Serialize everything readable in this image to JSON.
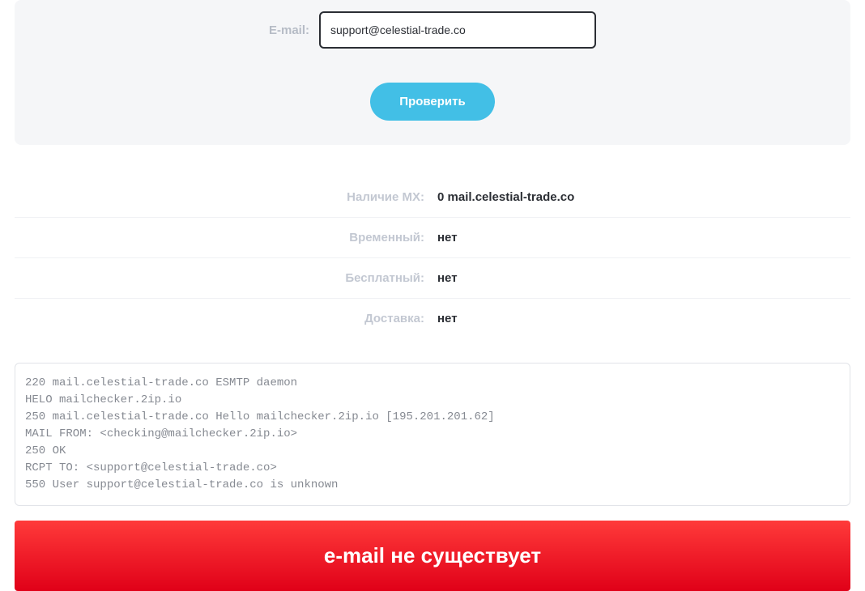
{
  "form": {
    "email_label": "E-mail:",
    "email_value": "support@celestial-trade.co",
    "check_button": "Проверить"
  },
  "result": {
    "mx_label": "Наличие MX:",
    "mx_value": "0 mail.celestial-trade.co",
    "temp_label": "Временный:",
    "temp_value": "нет",
    "free_label": "Бесплатный:",
    "free_value": "нет",
    "delivery_label": "Доставка:",
    "delivery_value": "нет"
  },
  "log": "220 mail.celestial-trade.co ESMTP daemon\nHELO mailchecker.2ip.io\n250 mail.celestial-trade.co Hello mailchecker.2ip.io [195.201.201.62]\nMAIL FROM: <checking@mailchecker.2ip.io>\n250 OK\nRCPT TO: <support@celestial-trade.co>\n550 User support@celestial-trade.co is unknown",
  "alert": "e-mail не существует"
}
